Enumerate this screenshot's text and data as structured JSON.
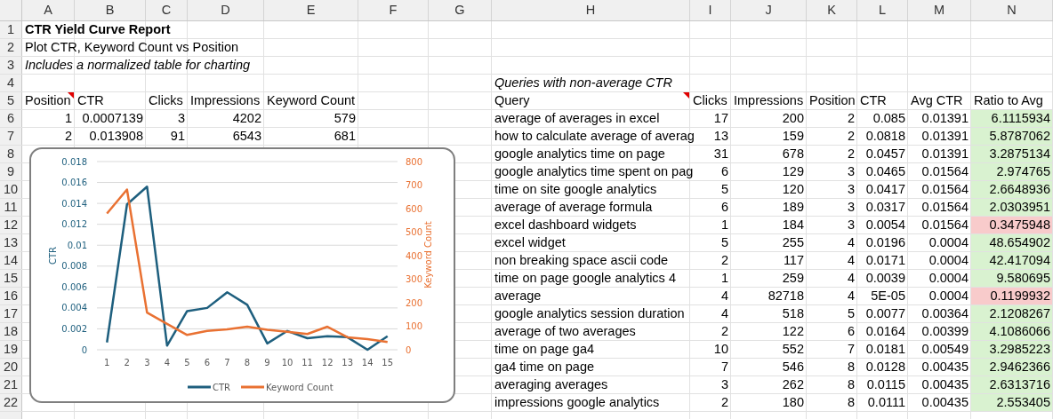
{
  "sheet": {
    "columns": [
      "A",
      "B",
      "C",
      "D",
      "E",
      "F",
      "G",
      "H",
      "I",
      "J",
      "K",
      "L",
      "M",
      "N"
    ],
    "rows": [
      {
        "number": "1",
        "cells": [
          {
            "kind": "title",
            "text": "CTR Yield Curve Report"
          }
        ]
      },
      {
        "number": "2",
        "cells": [
          {
            "kind": "subtitle",
            "text": "Plot CTR, Keyword Count vs Position"
          }
        ]
      },
      {
        "number": "3",
        "cells": [
          {
            "kind": "note",
            "text": "Includes a normalized table for charting"
          }
        ]
      },
      {
        "number": "4",
        "cells": [
          "",
          "",
          "",
          "",
          "",
          "",
          "",
          {
            "kind": "note",
            "text": "Queries with non-average CTR"
          }
        ]
      },
      {
        "number": "5",
        "cells": [
          {
            "kind": "header",
            "text": "Position",
            "comment": true
          },
          {
            "kind": "header",
            "text": "CTR"
          },
          {
            "kind": "header",
            "text": "Clicks"
          },
          {
            "kind": "header",
            "text": "Impressions"
          },
          {
            "kind": "header",
            "text": "Keyword Count"
          },
          "",
          "",
          {
            "kind": "header",
            "text": "Query",
            "comment": true
          },
          {
            "kind": "header",
            "text": "Clicks"
          },
          {
            "kind": "header",
            "text": "Impressions"
          },
          {
            "kind": "header",
            "text": "Position"
          },
          {
            "kind": "header",
            "text": "CTR"
          },
          {
            "kind": "header",
            "text": "Avg CTR"
          },
          {
            "kind": "header",
            "text": "Ratio to Avg"
          }
        ]
      },
      {
        "number": "6",
        "cells": [
          {
            "kind": "number",
            "text": "1"
          },
          {
            "kind": "number",
            "text": "0.0007139"
          },
          {
            "kind": "number",
            "text": "3"
          },
          {
            "kind": "number",
            "text": "4202"
          },
          {
            "kind": "number",
            "text": "579"
          },
          "",
          "",
          {
            "kind": "text",
            "text": "average of averages in excel"
          },
          {
            "kind": "number",
            "text": "17"
          },
          {
            "kind": "number",
            "text": "200"
          },
          {
            "kind": "number",
            "text": "2"
          },
          {
            "kind": "number",
            "text": "0.085"
          },
          {
            "kind": "number",
            "text": "0.01391"
          },
          {
            "kind": "number",
            "text": "6.1115934",
            "color": "#d9f2d0"
          }
        ]
      },
      {
        "number": "7",
        "cells": [
          {
            "kind": "number",
            "text": "2"
          },
          {
            "kind": "number",
            "text": "0.013908"
          },
          {
            "kind": "number",
            "text": "91"
          },
          {
            "kind": "number",
            "text": "6543"
          },
          {
            "kind": "number",
            "text": "681"
          },
          "",
          "",
          {
            "kind": "text",
            "text": "how to calculate average of averag"
          },
          {
            "kind": "number",
            "text": "13"
          },
          {
            "kind": "number",
            "text": "159"
          },
          {
            "kind": "number",
            "text": "2"
          },
          {
            "kind": "number",
            "text": "0.0818"
          },
          {
            "kind": "number",
            "text": "0.01391"
          },
          {
            "kind": "number",
            "text": "5.8787062",
            "color": "#d9f2d0"
          }
        ]
      },
      {
        "number": "8",
        "cells": [
          "",
          "",
          "",
          "",
          "",
          "",
          "",
          {
            "kind": "text",
            "text": "google analytics time on page"
          },
          {
            "kind": "number",
            "text": "31"
          },
          {
            "kind": "number",
            "text": "678"
          },
          {
            "kind": "number",
            "text": "2"
          },
          {
            "kind": "number",
            "text": "0.0457"
          },
          {
            "kind": "number",
            "text": "0.01391"
          },
          {
            "kind": "number",
            "text": "3.2875134",
            "color": "#d9f2d0"
          }
        ]
      },
      {
        "number": "9",
        "cells": [
          "",
          "",
          "",
          "",
          "",
          "",
          "",
          {
            "kind": "text",
            "text": "google analytics time spent on pag"
          },
          {
            "kind": "number",
            "text": "6"
          },
          {
            "kind": "number",
            "text": "129"
          },
          {
            "kind": "number",
            "text": "3"
          },
          {
            "kind": "number",
            "text": "0.0465"
          },
          {
            "kind": "number",
            "text": "0.01564"
          },
          {
            "kind": "number",
            "text": "2.974765",
            "color": "#d9f2d0"
          }
        ]
      },
      {
        "number": "10",
        "cells": [
          "",
          "",
          "",
          "",
          "",
          "",
          "",
          {
            "kind": "text",
            "text": "time on site google analytics"
          },
          {
            "kind": "number",
            "text": "5"
          },
          {
            "kind": "number",
            "text": "120"
          },
          {
            "kind": "number",
            "text": "3"
          },
          {
            "kind": "number",
            "text": "0.0417"
          },
          {
            "kind": "number",
            "text": "0.01564"
          },
          {
            "kind": "number",
            "text": "2.6648936",
            "color": "#d9f2d0"
          }
        ]
      },
      {
        "number": "11",
        "cells": [
          "",
          "",
          "",
          "",
          "",
          "",
          "",
          {
            "kind": "text",
            "text": "average of average formula"
          },
          {
            "kind": "number",
            "text": "6"
          },
          {
            "kind": "number",
            "text": "189"
          },
          {
            "kind": "number",
            "text": "3"
          },
          {
            "kind": "number",
            "text": "0.0317"
          },
          {
            "kind": "number",
            "text": "0.01564"
          },
          {
            "kind": "number",
            "text": "2.0303951",
            "color": "#d9f2d0"
          }
        ]
      },
      {
        "number": "12",
        "cells": [
          "",
          "",
          "",
          "",
          "",
          "",
          "",
          {
            "kind": "text",
            "text": "excel dashboard widgets"
          },
          {
            "kind": "number",
            "text": "1"
          },
          {
            "kind": "number",
            "text": "184"
          },
          {
            "kind": "number",
            "text": "3"
          },
          {
            "kind": "number",
            "text": "0.0054"
          },
          {
            "kind": "number",
            "text": "0.01564"
          },
          {
            "kind": "number",
            "text": "0.3475948",
            "color": "#f8cbcb"
          }
        ]
      },
      {
        "number": "13",
        "cells": [
          "",
          "",
          "",
          "",
          "",
          "",
          "",
          {
            "kind": "text",
            "text": "excel widget"
          },
          {
            "kind": "number",
            "text": "5"
          },
          {
            "kind": "number",
            "text": "255"
          },
          {
            "kind": "number",
            "text": "4"
          },
          {
            "kind": "number",
            "text": "0.0196"
          },
          {
            "kind": "number",
            "text": "0.0004"
          },
          {
            "kind": "number",
            "text": "48.654902",
            "color": "#d9f2d0"
          }
        ]
      },
      {
        "number": "14",
        "cells": [
          "",
          "",
          "",
          "",
          "",
          "",
          "",
          {
            "kind": "text",
            "text": "non breaking space ascii code"
          },
          {
            "kind": "number",
            "text": "2"
          },
          {
            "kind": "number",
            "text": "117"
          },
          {
            "kind": "number",
            "text": "4"
          },
          {
            "kind": "number",
            "text": "0.0171"
          },
          {
            "kind": "number",
            "text": "0.0004"
          },
          {
            "kind": "number",
            "text": "42.417094",
            "color": "#d9f2d0"
          }
        ]
      },
      {
        "number": "15",
        "cells": [
          "",
          "",
          "",
          "",
          "",
          "",
          "",
          {
            "kind": "text",
            "text": "time on page google analytics 4"
          },
          {
            "kind": "number",
            "text": "1"
          },
          {
            "kind": "number",
            "text": "259"
          },
          {
            "kind": "number",
            "text": "4"
          },
          {
            "kind": "number",
            "text": "0.0039"
          },
          {
            "kind": "number",
            "text": "0.0004"
          },
          {
            "kind": "number",
            "text": "9.580695",
            "color": "#d9f2d0"
          }
        ]
      },
      {
        "number": "16",
        "cells": [
          "",
          "",
          "",
          "",
          "",
          "",
          "",
          {
            "kind": "text",
            "text": "average"
          },
          {
            "kind": "number",
            "text": "4"
          },
          {
            "kind": "number",
            "text": "82718"
          },
          {
            "kind": "number",
            "text": "4"
          },
          {
            "kind": "number",
            "text": "5E-05"
          },
          {
            "kind": "number",
            "text": "0.0004"
          },
          {
            "kind": "number",
            "text": "0.1199932",
            "color": "#f8cbcb"
          }
        ]
      },
      {
        "number": "17",
        "cells": [
          "",
          "",
          "",
          "",
          "",
          "",
          "",
          {
            "kind": "text",
            "text": "google analytics session duration"
          },
          {
            "kind": "number",
            "text": "4"
          },
          {
            "kind": "number",
            "text": "518"
          },
          {
            "kind": "number",
            "text": "5"
          },
          {
            "kind": "number",
            "text": "0.0077"
          },
          {
            "kind": "number",
            "text": "0.00364"
          },
          {
            "kind": "number",
            "text": "2.1208267",
            "color": "#d9f2d0"
          }
        ]
      },
      {
        "number": "18",
        "cells": [
          "",
          "",
          "",
          "",
          "",
          "",
          "",
          {
            "kind": "text",
            "text": "average of two averages"
          },
          {
            "kind": "number",
            "text": "2"
          },
          {
            "kind": "number",
            "text": "122"
          },
          {
            "kind": "number",
            "text": "6"
          },
          {
            "kind": "number",
            "text": "0.0164"
          },
          {
            "kind": "number",
            "text": "0.00399"
          },
          {
            "kind": "number",
            "text": "4.1086066",
            "color": "#d9f2d0"
          }
        ]
      },
      {
        "number": "19",
        "cells": [
          "",
          "",
          "",
          "",
          "",
          "",
          "",
          {
            "kind": "text",
            "text": "time on page ga4"
          },
          {
            "kind": "number",
            "text": "10"
          },
          {
            "kind": "number",
            "text": "552"
          },
          {
            "kind": "number",
            "text": "7"
          },
          {
            "kind": "number",
            "text": "0.0181"
          },
          {
            "kind": "number",
            "text": "0.00549"
          },
          {
            "kind": "number",
            "text": "3.2985223",
            "color": "#d9f2d0"
          }
        ]
      },
      {
        "number": "20",
        "cells": [
          "",
          "",
          "",
          "",
          "",
          "",
          "",
          {
            "kind": "text",
            "text": "ga4 time on page"
          },
          {
            "kind": "number",
            "text": "7"
          },
          {
            "kind": "number",
            "text": "546"
          },
          {
            "kind": "number",
            "text": "8"
          },
          {
            "kind": "number",
            "text": "0.0128"
          },
          {
            "kind": "number",
            "text": "0.00435"
          },
          {
            "kind": "number",
            "text": "2.9462366",
            "color": "#d9f2d0"
          }
        ]
      },
      {
        "number": "21",
        "cells": [
          "",
          "",
          "",
          "",
          "",
          "",
          "",
          {
            "kind": "text",
            "text": "averaging averages"
          },
          {
            "kind": "number",
            "text": "3"
          },
          {
            "kind": "number",
            "text": "262"
          },
          {
            "kind": "number",
            "text": "8"
          },
          {
            "kind": "number",
            "text": "0.0115"
          },
          {
            "kind": "number",
            "text": "0.00435"
          },
          {
            "kind": "number",
            "text": "2.6313716",
            "color": "#d9f2d0"
          }
        ]
      },
      {
        "number": "22",
        "cells": [
          "",
          "",
          "",
          "",
          "",
          "",
          "",
          {
            "kind": "text",
            "text": "impressions google analytics"
          },
          {
            "kind": "number",
            "text": "2"
          },
          {
            "kind": "number",
            "text": "180"
          },
          {
            "kind": "number",
            "text": "8"
          },
          {
            "kind": "number",
            "text": "0.0111"
          },
          {
            "kind": "number",
            "text": "0.00435"
          },
          {
            "kind": "number",
            "text": "2.553405",
            "color": "#d9f2d0"
          }
        ]
      }
    ]
  },
  "chart": {
    "chart_data": {
      "type": "line",
      "ylabel": "CTR",
      "y2label": "Keyword Count",
      "x": [
        1,
        2,
        3,
        4,
        5,
        6,
        7,
        8,
        9,
        10,
        11,
        12,
        13,
        14,
        15
      ],
      "xlim": [
        0.5,
        15.5
      ],
      "grid": true,
      "legend": true,
      "xticks": [
        1,
        2,
        3,
        4,
        5,
        6,
        7,
        8,
        9,
        10,
        11,
        12,
        13,
        14,
        15
      ],
      "ylim": [
        0,
        0.018
      ],
      "yticks": [
        0,
        0.002,
        0.004,
        0.006,
        0.008,
        0.01,
        0.012,
        0.014,
        0.016,
        0.018
      ],
      "y2lim": [
        0,
        800
      ],
      "y2ticks": [
        0,
        100,
        200,
        300,
        400,
        500,
        600,
        700,
        800
      ],
      "series": [
        {
          "name": "CTR",
          "color": "#1e5f7e",
          "values": [
            0.0007,
            0.0139,
            0.0156,
            0.0004,
            0.0037,
            0.004,
            0.0055,
            0.0043,
            0.0006,
            0.0018,
            0.0011,
            0.0013,
            0.0012,
            0.0,
            0.0013
          ]
        },
        {
          "name": "Keyword Count",
          "color": "#e97132",
          "axis": "y2",
          "values": [
            579,
            681,
            158,
            110,
            63,
            80,
            87,
            98,
            85,
            76,
            67,
            98,
            53,
            45,
            33
          ]
        }
      ]
    }
  }
}
